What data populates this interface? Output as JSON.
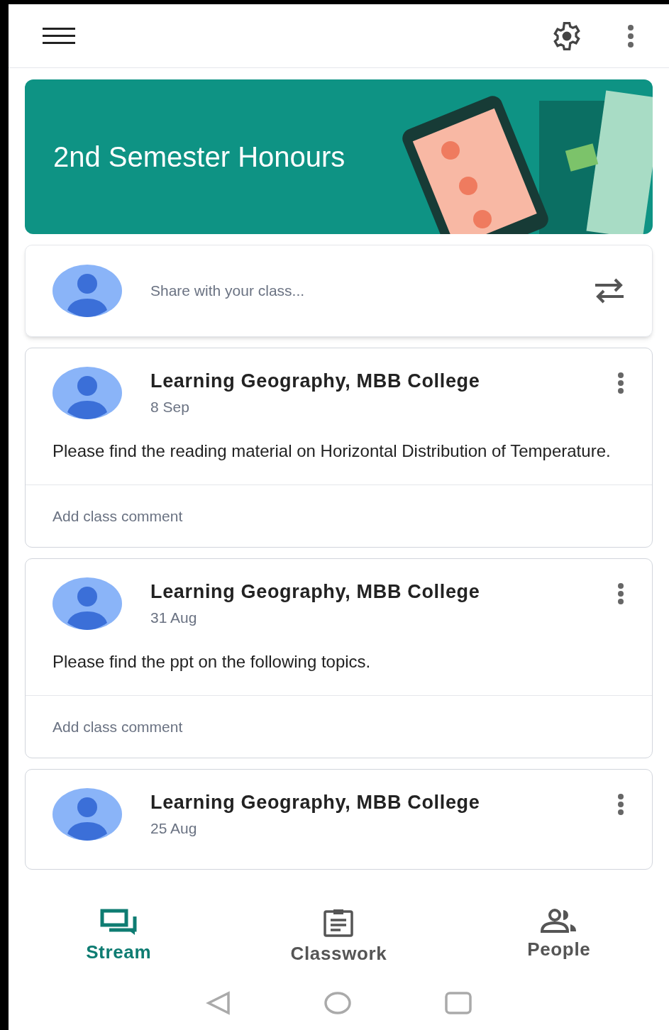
{
  "class_banner": {
    "title": "2nd Semester Honours"
  },
  "share_box": {
    "placeholder": "Share with your class..."
  },
  "posts": [
    {
      "author": "Learning Geography, MBB College",
      "date": "8 Sep",
      "body": "Please find the reading material on Horizontal Distribution of Temperature.",
      "comment_placeholder": "Add class comment"
    },
    {
      "author": "Learning Geography, MBB College",
      "date": "31 Aug",
      "body": "Please find the ppt on the following topics.",
      "comment_placeholder": "Add class comment"
    },
    {
      "author": "Learning Geography, MBB College",
      "date": "25 Aug"
    }
  ],
  "bottom_nav": [
    {
      "kind": "stream",
      "label": "Stream",
      "selected": true
    },
    {
      "kind": "classwork",
      "label": "Classwork",
      "selected": false
    },
    {
      "kind": "people",
      "label": "People",
      "selected": false
    }
  ]
}
